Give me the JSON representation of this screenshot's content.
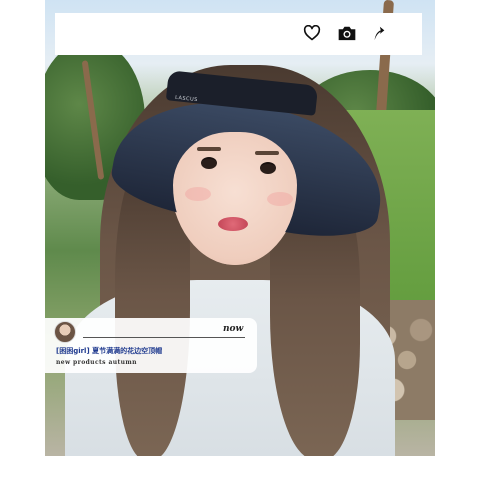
{
  "topbar": {
    "icons": [
      "heart-icon",
      "camera-icon",
      "share-arrow-icon"
    ]
  },
  "card": {
    "time_label": "now",
    "title": "[困困girl] 夏节满满的花边空顶帽",
    "subtitle": "new products autumn"
  },
  "photo": {
    "visor_logo": "LASCUS"
  },
  "colors": {
    "card_title": "#1f3a8f",
    "visor": "#2a3447",
    "background": "#ffffff"
  }
}
